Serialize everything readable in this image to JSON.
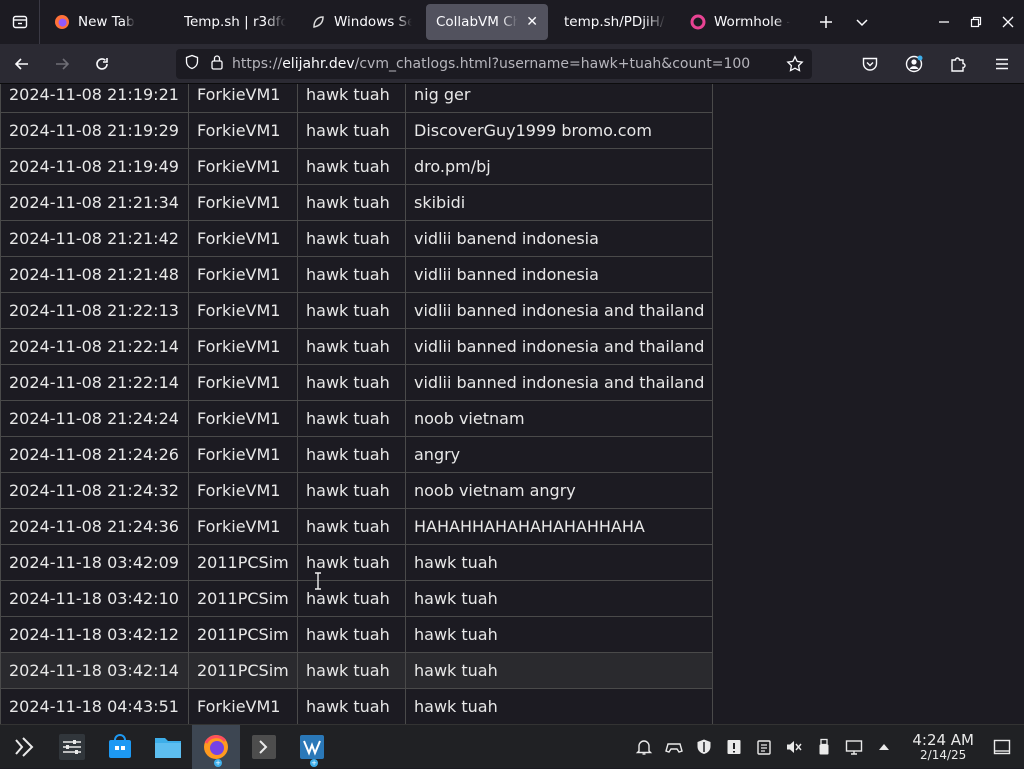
{
  "tabs": [
    {
      "title": "New Tab",
      "icon": "firefox-icon",
      "active": false
    },
    {
      "title": "Temp.sh | r3dfox",
      "icon": "none",
      "active": false
    },
    {
      "title": "Windows Serv",
      "icon": "leaf-icon",
      "active": false
    },
    {
      "title": "CollabVM Chat",
      "icon": "none",
      "active": true
    },
    {
      "title": "temp.sh/PDjiH/h",
      "icon": "none",
      "active": false
    },
    {
      "title": "Wormhole - S",
      "icon": "wormhole-icon",
      "active": false
    }
  ],
  "urlbar": {
    "prefix": "https://",
    "host": "elijahr.dev",
    "path": "/cvm_chatlogs.html?username=hawk+tuah&count=100"
  },
  "rows": [
    [
      "2024-11-08 21:19:21",
      "ForkieVM1",
      "hawk tuah",
      "nig ger"
    ],
    [
      "2024-11-08 21:19:29",
      "ForkieVM1",
      "hawk tuah",
      "DiscoverGuy1999 bromo.com"
    ],
    [
      "2024-11-08 21:19:49",
      "ForkieVM1",
      "hawk tuah",
      "dro.pm/bj"
    ],
    [
      "2024-11-08 21:21:34",
      "ForkieVM1",
      "hawk tuah",
      "skibidi"
    ],
    [
      "2024-11-08 21:21:42",
      "ForkieVM1",
      "hawk tuah",
      "vidlii banend indonesia"
    ],
    [
      "2024-11-08 21:21:48",
      "ForkieVM1",
      "hawk tuah",
      "vidlii banned indonesia"
    ],
    [
      "2024-11-08 21:22:13",
      "ForkieVM1",
      "hawk tuah",
      "vidlii banned indonesia and thailand"
    ],
    [
      "2024-11-08 21:22:14",
      "ForkieVM1",
      "hawk tuah",
      "vidlii banned indonesia and thailand"
    ],
    [
      "2024-11-08 21:22:14",
      "ForkieVM1",
      "hawk tuah",
      "vidlii banned indonesia and thailand"
    ],
    [
      "2024-11-08 21:24:24",
      "ForkieVM1",
      "hawk tuah",
      "noob vietnam"
    ],
    [
      "2024-11-08 21:24:26",
      "ForkieVM1",
      "hawk tuah",
      "angry"
    ],
    [
      "2024-11-08 21:24:32",
      "ForkieVM1",
      "hawk tuah",
      "noob vietnam angry"
    ],
    [
      "2024-11-08 21:24:36",
      "ForkieVM1",
      "hawk tuah",
      "HAHAHHAHAHAHAHAHHAHA"
    ],
    [
      "2024-11-18 03:42:09",
      "2011PCSim",
      "hawk tuah",
      "hawk tuah"
    ],
    [
      "2024-11-18 03:42:10",
      "2011PCSim",
      "hawk tuah",
      "hawk tuah"
    ],
    [
      "2024-11-18 03:42:12",
      "2011PCSim",
      "hawk tuah",
      "hawk tuah"
    ],
    [
      "2024-11-18 03:42:14",
      "2011PCSim",
      "hawk tuah",
      "hawk tuah"
    ],
    [
      "2024-11-18 04:43:51",
      "ForkieVM1",
      "hawk tuah",
      "hawk tuah"
    ]
  ],
  "hover_row": 16,
  "taskbar": {
    "apps": [
      "overview-icon",
      "settings-icon",
      "store-icon",
      "file-manager-icon",
      "firefox-icon",
      "terminal-icon",
      "vm-icon"
    ],
    "active_app": 4
  },
  "clock": {
    "time": "4:24 AM",
    "date": "2/14/25"
  },
  "colors": {
    "accent": "#3daee9",
    "background": "#1c1b22",
    "active_tab": "#52525e"
  }
}
